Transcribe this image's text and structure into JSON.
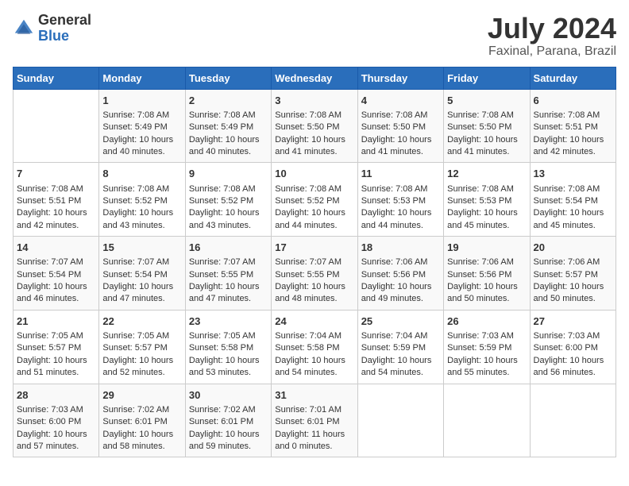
{
  "header": {
    "logo_general": "General",
    "logo_blue": "Blue",
    "title": "July 2024",
    "subtitle": "Faxinal, Parana, Brazil"
  },
  "days_of_week": [
    "Sunday",
    "Monday",
    "Tuesday",
    "Wednesday",
    "Thursday",
    "Friday",
    "Saturday"
  ],
  "weeks": [
    [
      {
        "num": "",
        "sunrise": "",
        "sunset": "",
        "daylight": "",
        "empty": true
      },
      {
        "num": "1",
        "sunrise": "Sunrise: 7:08 AM",
        "sunset": "Sunset: 5:49 PM",
        "daylight": "Daylight: 10 hours and 40 minutes."
      },
      {
        "num": "2",
        "sunrise": "Sunrise: 7:08 AM",
        "sunset": "Sunset: 5:49 PM",
        "daylight": "Daylight: 10 hours and 40 minutes."
      },
      {
        "num": "3",
        "sunrise": "Sunrise: 7:08 AM",
        "sunset": "Sunset: 5:50 PM",
        "daylight": "Daylight: 10 hours and 41 minutes."
      },
      {
        "num": "4",
        "sunrise": "Sunrise: 7:08 AM",
        "sunset": "Sunset: 5:50 PM",
        "daylight": "Daylight: 10 hours and 41 minutes."
      },
      {
        "num": "5",
        "sunrise": "Sunrise: 7:08 AM",
        "sunset": "Sunset: 5:50 PM",
        "daylight": "Daylight: 10 hours and 41 minutes."
      },
      {
        "num": "6",
        "sunrise": "Sunrise: 7:08 AM",
        "sunset": "Sunset: 5:51 PM",
        "daylight": "Daylight: 10 hours and 42 minutes."
      }
    ],
    [
      {
        "num": "7",
        "sunrise": "Sunrise: 7:08 AM",
        "sunset": "Sunset: 5:51 PM",
        "daylight": "Daylight: 10 hours and 42 minutes."
      },
      {
        "num": "8",
        "sunrise": "Sunrise: 7:08 AM",
        "sunset": "Sunset: 5:52 PM",
        "daylight": "Daylight: 10 hours and 43 minutes."
      },
      {
        "num": "9",
        "sunrise": "Sunrise: 7:08 AM",
        "sunset": "Sunset: 5:52 PM",
        "daylight": "Daylight: 10 hours and 43 minutes."
      },
      {
        "num": "10",
        "sunrise": "Sunrise: 7:08 AM",
        "sunset": "Sunset: 5:52 PM",
        "daylight": "Daylight: 10 hours and 44 minutes."
      },
      {
        "num": "11",
        "sunrise": "Sunrise: 7:08 AM",
        "sunset": "Sunset: 5:53 PM",
        "daylight": "Daylight: 10 hours and 44 minutes."
      },
      {
        "num": "12",
        "sunrise": "Sunrise: 7:08 AM",
        "sunset": "Sunset: 5:53 PM",
        "daylight": "Daylight: 10 hours and 45 minutes."
      },
      {
        "num": "13",
        "sunrise": "Sunrise: 7:08 AM",
        "sunset": "Sunset: 5:54 PM",
        "daylight": "Daylight: 10 hours and 45 minutes."
      }
    ],
    [
      {
        "num": "14",
        "sunrise": "Sunrise: 7:07 AM",
        "sunset": "Sunset: 5:54 PM",
        "daylight": "Daylight: 10 hours and 46 minutes."
      },
      {
        "num": "15",
        "sunrise": "Sunrise: 7:07 AM",
        "sunset": "Sunset: 5:54 PM",
        "daylight": "Daylight: 10 hours and 47 minutes."
      },
      {
        "num": "16",
        "sunrise": "Sunrise: 7:07 AM",
        "sunset": "Sunset: 5:55 PM",
        "daylight": "Daylight: 10 hours and 47 minutes."
      },
      {
        "num": "17",
        "sunrise": "Sunrise: 7:07 AM",
        "sunset": "Sunset: 5:55 PM",
        "daylight": "Daylight: 10 hours and 48 minutes."
      },
      {
        "num": "18",
        "sunrise": "Sunrise: 7:06 AM",
        "sunset": "Sunset: 5:56 PM",
        "daylight": "Daylight: 10 hours and 49 minutes."
      },
      {
        "num": "19",
        "sunrise": "Sunrise: 7:06 AM",
        "sunset": "Sunset: 5:56 PM",
        "daylight": "Daylight: 10 hours and 50 minutes."
      },
      {
        "num": "20",
        "sunrise": "Sunrise: 7:06 AM",
        "sunset": "Sunset: 5:57 PM",
        "daylight": "Daylight: 10 hours and 50 minutes."
      }
    ],
    [
      {
        "num": "21",
        "sunrise": "Sunrise: 7:05 AM",
        "sunset": "Sunset: 5:57 PM",
        "daylight": "Daylight: 10 hours and 51 minutes."
      },
      {
        "num": "22",
        "sunrise": "Sunrise: 7:05 AM",
        "sunset": "Sunset: 5:57 PM",
        "daylight": "Daylight: 10 hours and 52 minutes."
      },
      {
        "num": "23",
        "sunrise": "Sunrise: 7:05 AM",
        "sunset": "Sunset: 5:58 PM",
        "daylight": "Daylight: 10 hours and 53 minutes."
      },
      {
        "num": "24",
        "sunrise": "Sunrise: 7:04 AM",
        "sunset": "Sunset: 5:58 PM",
        "daylight": "Daylight: 10 hours and 54 minutes."
      },
      {
        "num": "25",
        "sunrise": "Sunrise: 7:04 AM",
        "sunset": "Sunset: 5:59 PM",
        "daylight": "Daylight: 10 hours and 54 minutes."
      },
      {
        "num": "26",
        "sunrise": "Sunrise: 7:03 AM",
        "sunset": "Sunset: 5:59 PM",
        "daylight": "Daylight: 10 hours and 55 minutes."
      },
      {
        "num": "27",
        "sunrise": "Sunrise: 7:03 AM",
        "sunset": "Sunset: 6:00 PM",
        "daylight": "Daylight: 10 hours and 56 minutes."
      }
    ],
    [
      {
        "num": "28",
        "sunrise": "Sunrise: 7:03 AM",
        "sunset": "Sunset: 6:00 PM",
        "daylight": "Daylight: 10 hours and 57 minutes."
      },
      {
        "num": "29",
        "sunrise": "Sunrise: 7:02 AM",
        "sunset": "Sunset: 6:01 PM",
        "daylight": "Daylight: 10 hours and 58 minutes."
      },
      {
        "num": "30",
        "sunrise": "Sunrise: 7:02 AM",
        "sunset": "Sunset: 6:01 PM",
        "daylight": "Daylight: 10 hours and 59 minutes."
      },
      {
        "num": "31",
        "sunrise": "Sunrise: 7:01 AM",
        "sunset": "Sunset: 6:01 PM",
        "daylight": "Daylight: 11 hours and 0 minutes."
      },
      {
        "num": "",
        "sunrise": "",
        "sunset": "",
        "daylight": "",
        "empty": true
      },
      {
        "num": "",
        "sunrise": "",
        "sunset": "",
        "daylight": "",
        "empty": true
      },
      {
        "num": "",
        "sunrise": "",
        "sunset": "",
        "daylight": "",
        "empty": true
      }
    ]
  ]
}
